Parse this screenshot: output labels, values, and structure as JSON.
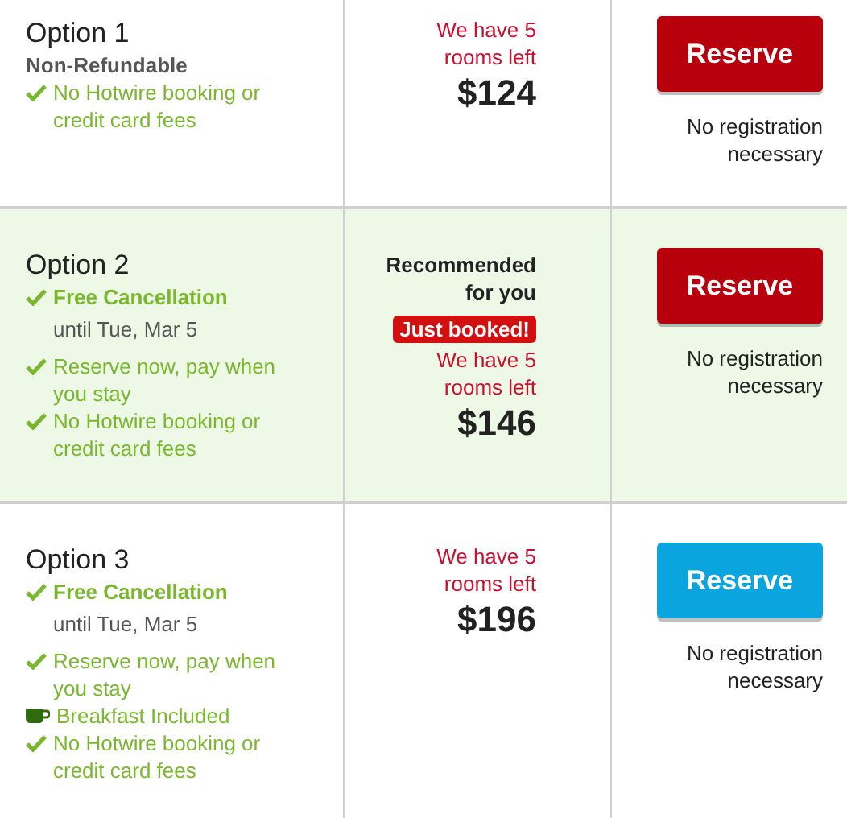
{
  "options": [
    {
      "title": "Option 1",
      "highlighted": false,
      "features": [
        {
          "kind": "note",
          "text": "Non-Refundable",
          "bold": true
        },
        {
          "kind": "check",
          "text": "No Hotwire booking or credit card fees",
          "bold": false
        }
      ],
      "availability": "We have 5 rooms left",
      "price": "$124",
      "button": {
        "label": "Reserve",
        "color": "#b8000c"
      },
      "note": "No registration necessary"
    },
    {
      "title": "Option 2",
      "highlighted": true,
      "features": [
        {
          "kind": "check",
          "text": "Free Cancellation",
          "bold": true,
          "detail": "until Tue, Mar 5"
        },
        {
          "kind": "check",
          "text": "Reserve now, pay when you stay",
          "bold": false
        },
        {
          "kind": "check",
          "text": "No Hotwire booking or credit card fees",
          "bold": false
        }
      ],
      "recommendation": "Recommended for you",
      "badge": "Just booked!",
      "availability": "We have 5 rooms left",
      "price": "$146",
      "button": {
        "label": "Reserve",
        "color": "#b8000c"
      },
      "note": "No registration necessary"
    },
    {
      "title": "Option 3",
      "highlighted": false,
      "features": [
        {
          "kind": "check",
          "text": "Free Cancellation",
          "bold": true,
          "detail": "until Tue, Mar 5"
        },
        {
          "kind": "check",
          "text": "Reserve now, pay when you stay",
          "bold": false
        },
        {
          "kind": "breakfast",
          "text": "Breakfast Included",
          "bold": false
        },
        {
          "kind": "check",
          "text": "No Hotwire booking or credit card fees",
          "bold": false
        }
      ],
      "availability": "We have 5 rooms left",
      "price": "$196",
      "button": {
        "label": "Reserve",
        "color": "#0aa4df"
      },
      "note": "No registration necessary"
    }
  ]
}
